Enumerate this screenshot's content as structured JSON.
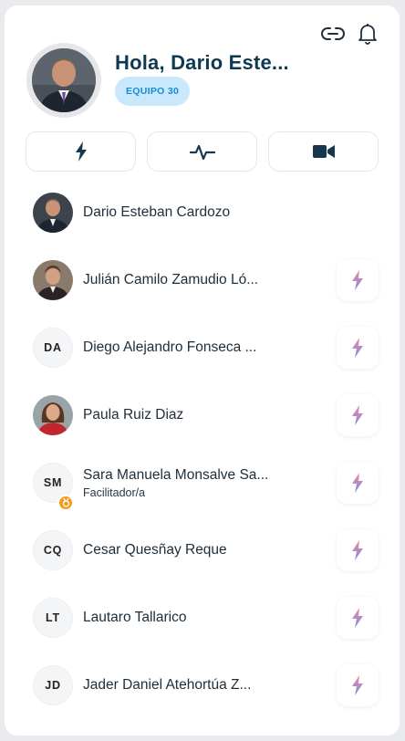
{
  "header": {
    "greeting": "Hola, Dario Este...",
    "team_badge": "EQUIPO 30",
    "link_icon": "link-icon",
    "bell_icon": "bell-icon"
  },
  "actions": [
    {
      "icon": "lightning-icon"
    },
    {
      "icon": "activity-icon"
    },
    {
      "icon": "video-icon"
    }
  ],
  "members": [
    {
      "name": "Dario Esteban Cardozo",
      "initials": "",
      "photo": true,
      "role": "",
      "has_action": false
    },
    {
      "name": "Julián Camilo Zamudio Ló...",
      "initials": "",
      "photo": true,
      "role": "",
      "has_action": true
    },
    {
      "name": "Diego Alejandro Fonseca ...",
      "initials": "DA",
      "photo": false,
      "role": "",
      "has_action": true
    },
    {
      "name": "Paula Ruiz Diaz",
      "initials": "",
      "photo": true,
      "role": "",
      "has_action": true
    },
    {
      "name": "Sara Manuela Monsalve Sa...",
      "initials": "SM",
      "photo": false,
      "role": "Facilitador/a",
      "has_action": true
    },
    {
      "name": "Cesar Quesñay Reque",
      "initials": "CQ",
      "photo": false,
      "role": "",
      "has_action": true
    },
    {
      "name": "Lautaro Tallarico",
      "initials": "LT",
      "photo": false,
      "role": "",
      "has_action": true
    },
    {
      "name": "Jader Daniel Atehortúa Z...",
      "initials": "JD",
      "photo": false,
      "role": "",
      "has_action": true
    }
  ],
  "colors": {
    "heading": "#0e3a50",
    "badge_bg": "#c9e8fb",
    "badge_text": "#1a8ad8",
    "medal": "#f59a1a"
  }
}
